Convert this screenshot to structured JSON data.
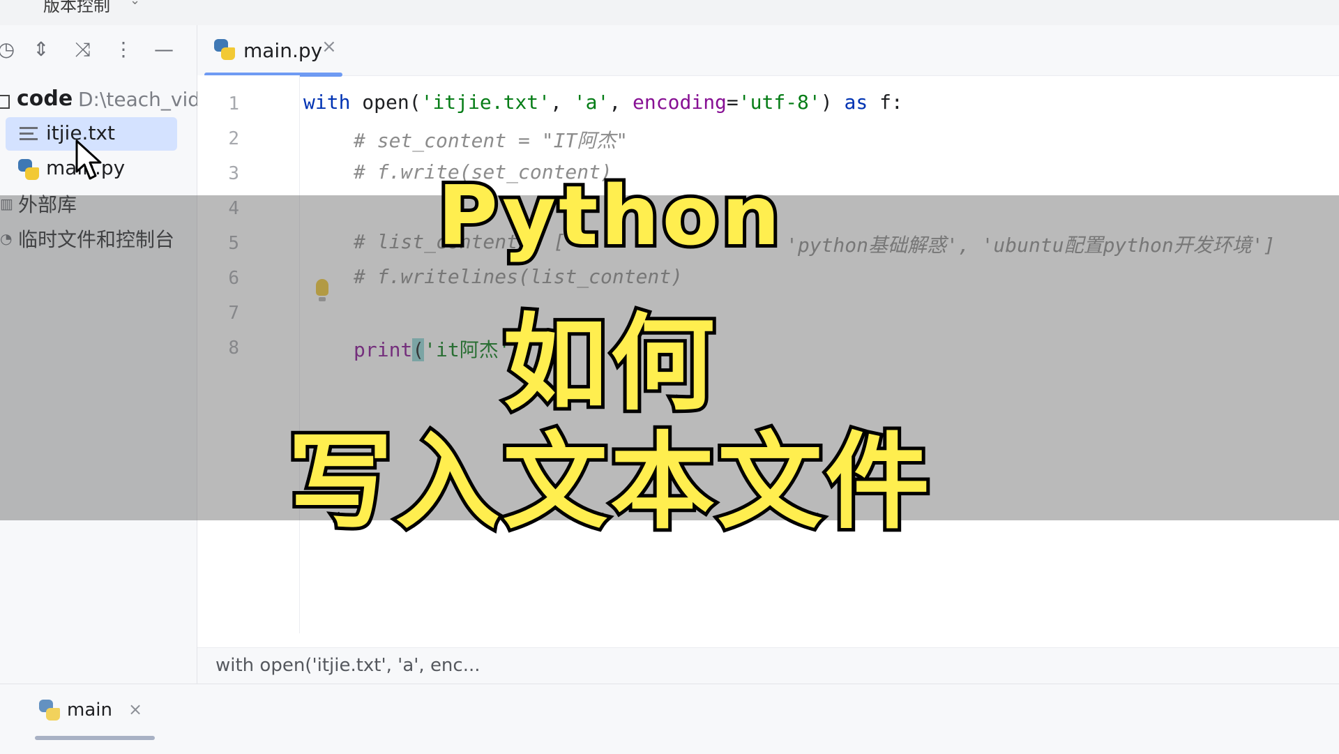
{
  "menu": {
    "vcs_label": "版本控制"
  },
  "project": {
    "root_name": "code",
    "root_path": "D:\\teach_vid",
    "files": [
      {
        "label": "itjie.txt",
        "icon": "text-file-icon",
        "selected": true
      },
      {
        "label": "main.py",
        "icon": "python-file-icon",
        "selected": false
      }
    ],
    "external_libs": "外部库",
    "scratches": "临时文件和控制台"
  },
  "editor": {
    "tab_label": "main.py",
    "line_numbers": [
      "1",
      "2",
      "3",
      "4",
      "5",
      "6",
      "7",
      "8"
    ],
    "line1": {
      "kw_with": "with",
      "fn_open": "open",
      "p1": "(",
      "s_file": "'itjie.txt'",
      "c1": ", ",
      "s_mode": "'a'",
      "c2": ", ",
      "param_enc": "encoding",
      "eq": "=",
      "s_enc": "'utf-8'",
      "p2": ") ",
      "kw_as": "as",
      "rest": " f:"
    },
    "line2": "# set_content = \"IT阿杰\"",
    "line3": "# f.write(set_content)",
    "line5a": "# list_content = [",
    "line5b": "'python基础解惑', 'ubuntu配置python开发环境']",
    "line6": "# f.writelines(list_content)",
    "line8": {
      "fn": "print",
      "open_paren": "(",
      "str": "'it阿杰'"
    },
    "breadcrumb": "with open('itjie.txt', 'a', enc..."
  },
  "run": {
    "tab_label": "main"
  },
  "overlay": {
    "title_line1": "Python",
    "title_line2": "如何",
    "title_line3": "写入文本文件"
  }
}
